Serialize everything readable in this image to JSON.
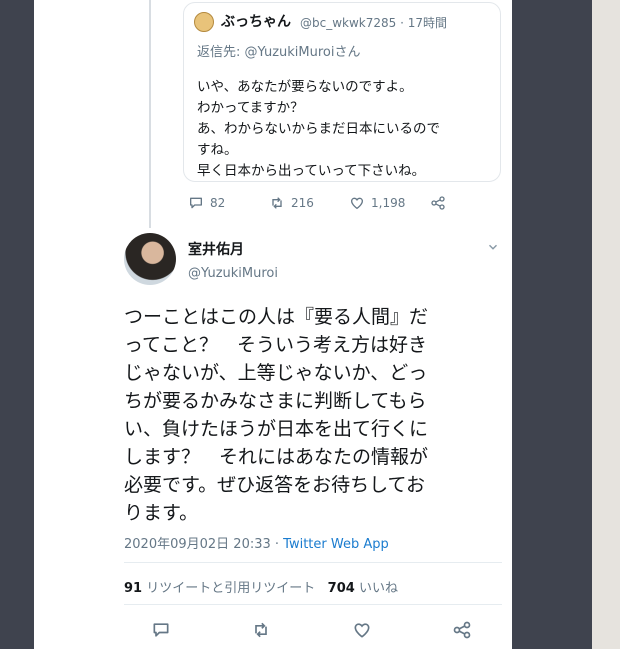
{
  "quoted_tweet": {
    "name": "ぶっちゃん",
    "handle": "@bc_wkwk7285",
    "time": "· 17時間",
    "reply_to": "返信先: @YuzukiMuroiさん",
    "lines": [
      "いや、あなたが要らないのですよ。",
      "わかってますか？",
      "あ、わからないからまだ日本にいるので",
      "すね。",
      "早く日本から出っていって下さいね。"
    ],
    "counts": {
      "replies": "82",
      "retweets": "216",
      "likes": "1,198"
    }
  },
  "main_tweet": {
    "name": "室井佑月",
    "handle": "@YuzukiMuroi",
    "body_lines": [
      "つーことはこの人は『要る人間』だ",
      "ってこと？　そういう考え方は好き",
      "じゃないが、上等じゃないか、どっ",
      "ちが要るかみなさまに判断してもら",
      "い、負けたほうが日本を出て行くに",
      "します？　それにはあなたの情報が",
      "必要です。ぜひ返答をお待ちしてお",
      "ります。"
    ],
    "timestamp": "2020年09月02日 20:33 ·",
    "source": "Twitter Web App",
    "retweet_count": "91",
    "retweet_label": "リツイートと引用リツイート",
    "like_count": "704",
    "like_label": "いいね"
  },
  "icons": {
    "reply": "reply-icon",
    "retweet": "retweet-icon",
    "like": "heart-icon",
    "share": "share-icon",
    "more": "chevron-down-icon"
  },
  "colors": {
    "link": "#1b7ccf",
    "text": "#14171a",
    "muted": "#657786",
    "frame": "#3f434e"
  }
}
